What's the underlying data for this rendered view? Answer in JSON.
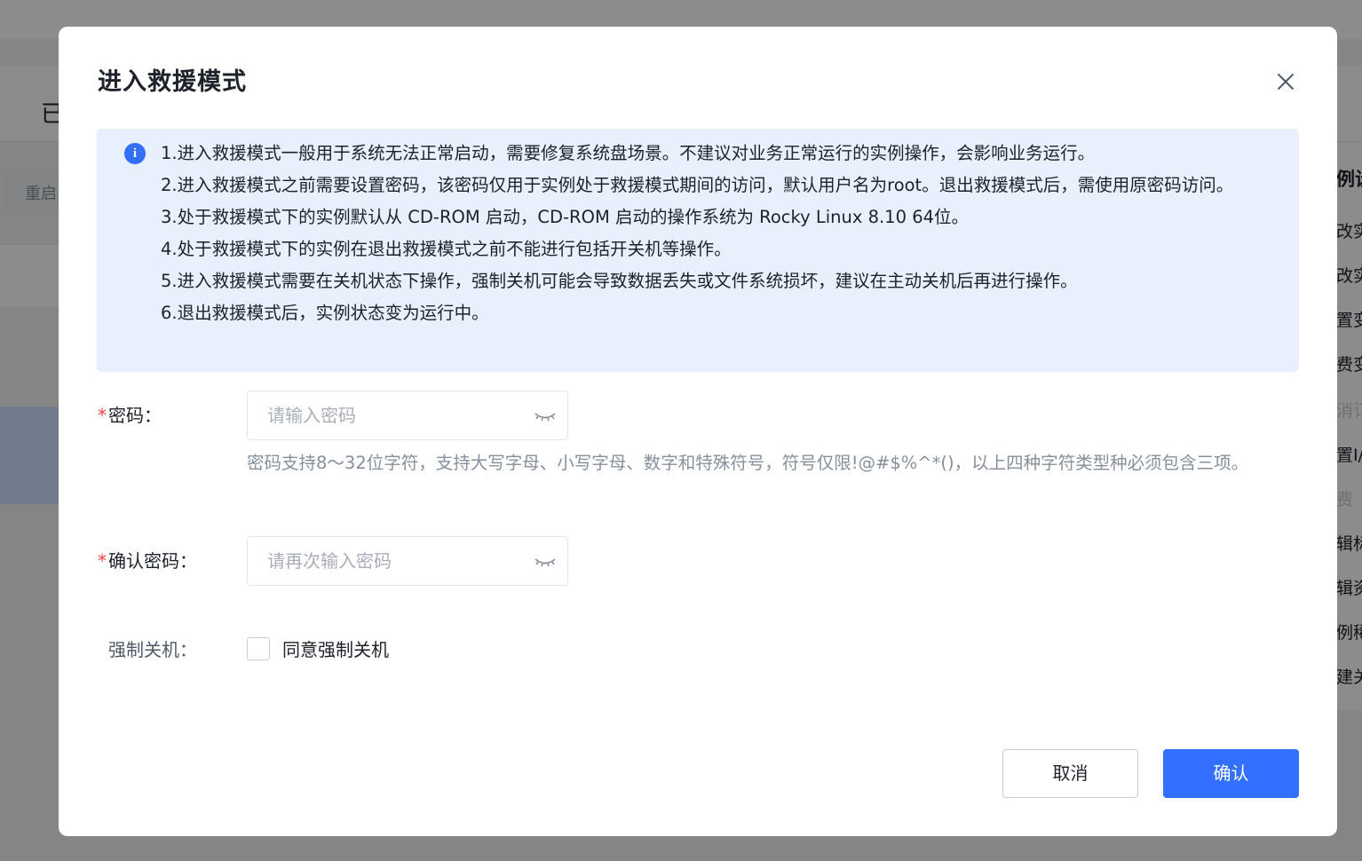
{
  "background": {
    "card_text": "已",
    "button_text": "重启",
    "menu_title": "例设",
    "menu_items": [
      "改实",
      "改实",
      "置变",
      "费变",
      "消订",
      "置I/",
      "费",
      "辑标",
      "辑资",
      "例稀",
      "建关"
    ]
  },
  "modal": {
    "title": "进入救援模式",
    "notice_items": [
      "1.进入救援模式一般用于系统无法正常启动，需要修复系统盘场景。不建议对业务正常运行的实例操作，会影响业务运行。",
      "2.进入救援模式之前需要设置密码，该密码仅用于实例处于救援模式期间的访问，默认用户名为root。退出救援模式后，需使用原密码访问。",
      "3.处于救援模式下的实例默认从 CD-ROM 启动，CD-ROM 启动的操作系统为 Rocky Linux 8.10 64位。",
      "4.处于救援模式下的实例在退出救援模式之前不能进行包括开关机等操作。",
      "5.进入救援模式需要在关机状态下操作，强制关机可能会导致数据丢失或文件系统损坏，建议在主动关机后再进行操作。",
      "6.退出救援模式后，实例状态变为运行中。"
    ],
    "password": {
      "label": "密码：",
      "placeholder": "请输入密码",
      "value": "",
      "hint": "密码支持8～32位字符，支持大写字母、小写字母、数字和特殊符号，符号仅限!@#$%^*()，以上四种字符类型种必须包含三项。"
    },
    "confirm_password": {
      "label": "确认密码：",
      "placeholder": "请再次输入密码",
      "value": ""
    },
    "force_shutdown": {
      "label": "强制关机：",
      "checkbox_label": "同意强制关机",
      "checked": false
    },
    "required_mark": "*",
    "buttons": {
      "cancel": "取消",
      "confirm": "确认"
    }
  },
  "colors": {
    "primary": "#3370ff",
    "notice_bg": "#e8f0fe",
    "required": "#f53f3f",
    "hint_text": "#86909c"
  }
}
